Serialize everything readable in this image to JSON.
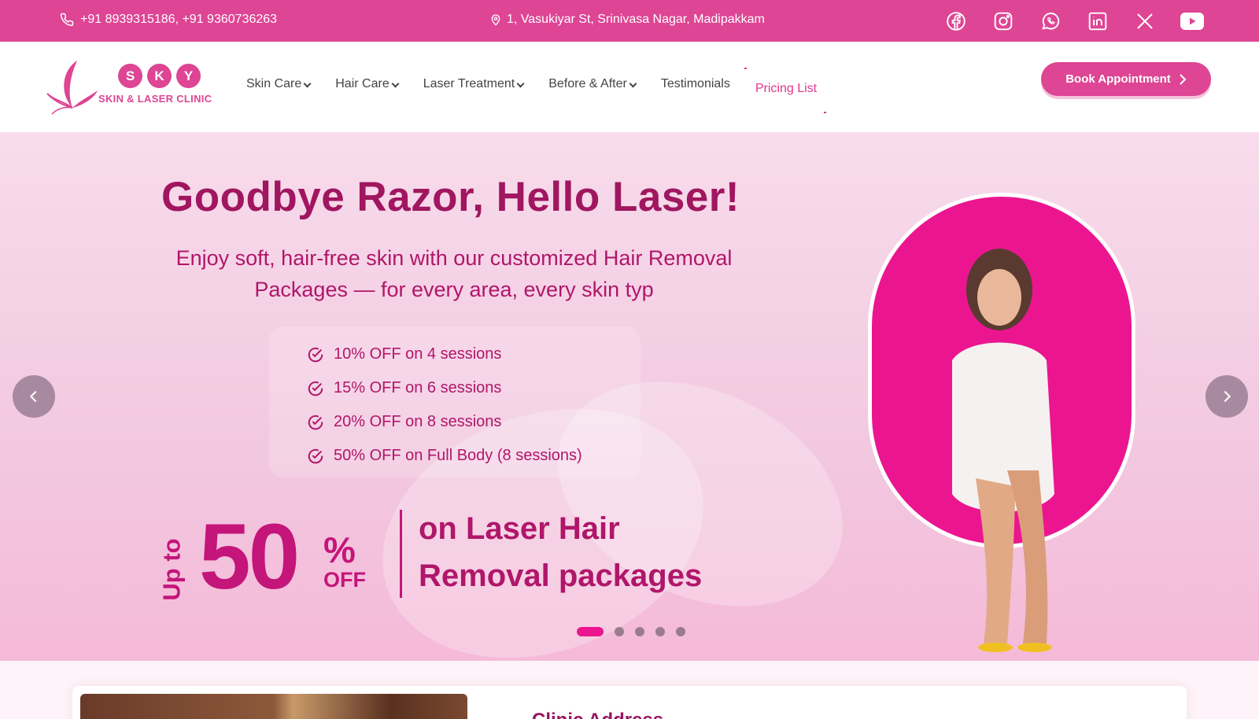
{
  "topbar": {
    "phone": "+91 8939315186, +91 9360736263",
    "address": "1, Vasukiyar St, Srinivasa Nagar, Madipakkam",
    "social_icons": [
      "facebook-icon",
      "instagram-icon",
      "whatsapp-icon",
      "linkedin-icon",
      "x-icon",
      "youtube-icon"
    ]
  },
  "logo": {
    "letters": [
      "S",
      "K",
      "Y"
    ],
    "tagline": "SKIN & LASER CLINIC"
  },
  "nav": {
    "items": [
      {
        "label": "Skin Care",
        "dropdown": true
      },
      {
        "label": "Hair Care",
        "dropdown": true
      },
      {
        "label": "Laser Treatment",
        "dropdown": true
      },
      {
        "label": "Before & After",
        "dropdown": true
      },
      {
        "label": "Testimonials",
        "dropdown": false
      },
      {
        "label": "Pricing List",
        "dropdown": false,
        "active": true
      }
    ],
    "cta": "Book Appointment"
  },
  "hero": {
    "title": "Goodbye Razor, Hello Laser!",
    "subtitle": "Enjoy soft, hair-free skin with our customized Hair Removal Packages — for every area, every skin typ",
    "offers": [
      "10% OFF on 4 sessions",
      "15% OFF on 6 sessions",
      "20% OFF on 8 sessions",
      "50% OFF on Full Body (8 sessions)"
    ],
    "promo": {
      "upto": "Up to",
      "number": "50",
      "percent": "%",
      "off": "OFF",
      "line1": "on Laser Hair",
      "line2": "Removal packages"
    },
    "slides": 5,
    "active_slide": 1
  },
  "info": {
    "title": "Clinic Address"
  },
  "colors": {
    "brand": "#de4594",
    "hero_text": "#b0166a",
    "accent": "#ec1590"
  }
}
